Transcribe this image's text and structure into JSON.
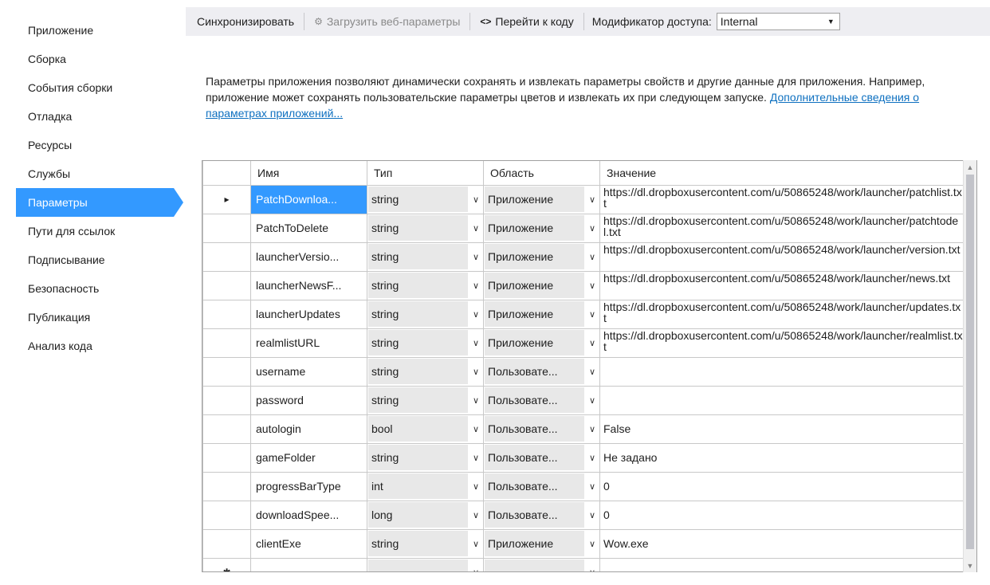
{
  "nav": {
    "items": [
      {
        "label": "Приложение"
      },
      {
        "label": "Сборка"
      },
      {
        "label": "События сборки"
      },
      {
        "label": "Отладка"
      },
      {
        "label": "Ресурсы"
      },
      {
        "label": "Службы"
      },
      {
        "label": "Параметры",
        "active": true
      },
      {
        "label": "Пути для ссылок"
      },
      {
        "label": "Подписывание"
      },
      {
        "label": "Безопасность"
      },
      {
        "label": "Публикация"
      },
      {
        "label": "Анализ кода"
      }
    ]
  },
  "toolbar": {
    "sync_label": "Синхронизировать",
    "load_web_label": "Загрузить веб-параметры",
    "goto_code_label": "Перейти к коду",
    "access_modifier_label": "Модификатор доступа:",
    "access_modifier_value": "Internal"
  },
  "description": {
    "text": "Параметры приложения позволяют динамически сохранять и извлекать параметры свойств и другие данные для приложения. Например, приложение может сохранять пользовательские параметры цветов и извлекать их при следующем запуске.",
    "link": "Дополнительные сведения о параметрах приложений..."
  },
  "grid": {
    "columns": {
      "name": "Имя",
      "type": "Тип",
      "scope": "Область",
      "value": "Значение"
    },
    "rows": [
      {
        "marker": "▸",
        "name": "PatchDownloa...",
        "type": "string",
        "scope": "Приложение",
        "value": "https://dl.dropboxusercontent.com/u/50865248/work/launcher/patchlist.txt"
      },
      {
        "marker": "",
        "name": "PatchToDelete",
        "type": "string",
        "scope": "Приложение",
        "value": "https://dl.dropboxusercontent.com/u/50865248/work/launcher/patchtodel.txt"
      },
      {
        "marker": "",
        "name": "launcherVersio...",
        "type": "string",
        "scope": "Приложение",
        "value": "https://dl.dropboxusercontent.com/u/50865248/work/launcher/version.txt"
      },
      {
        "marker": "",
        "name": "launcherNewsF...",
        "type": "string",
        "scope": "Приложение",
        "value": "https://dl.dropboxusercontent.com/u/50865248/work/launcher/news.txt"
      },
      {
        "marker": "",
        "name": "launcherUpdates",
        "type": "string",
        "scope": "Приложение",
        "value": "https://dl.dropboxusercontent.com/u/50865248/work/launcher/updates.txt"
      },
      {
        "marker": "",
        "name": "realmlistURL",
        "type": "string",
        "scope": "Приложение",
        "value": "https://dl.dropboxusercontent.com/u/50865248/work/launcher/realmlist.txt"
      },
      {
        "marker": "",
        "name": "username",
        "type": "string",
        "scope": "Пользовате...",
        "value": ""
      },
      {
        "marker": "",
        "name": "password",
        "type": "string",
        "scope": "Пользовате...",
        "value": ""
      },
      {
        "marker": "",
        "name": "autologin",
        "type": "bool",
        "scope": "Пользовате...",
        "value": "False"
      },
      {
        "marker": "",
        "name": "gameFolder",
        "type": "string",
        "scope": "Пользовате...",
        "value": "Не задано"
      },
      {
        "marker": "",
        "name": "progressBarType",
        "type": "int",
        "scope": "Пользовате...",
        "value": "0"
      },
      {
        "marker": "",
        "name": "downloadSpee...",
        "type": "long",
        "scope": "Пользовате...",
        "value": "0"
      },
      {
        "marker": "",
        "name": "clientExe",
        "type": "string",
        "scope": "Приложение",
        "value": "Wow.exe"
      },
      {
        "marker": "✱",
        "name": "",
        "type": "",
        "scope": "",
        "value": ""
      }
    ]
  },
  "icons": {
    "load_web": "web-settings-icon",
    "goto_code": "code-brackets-icon",
    "dropdown": "chevron-down-icon"
  }
}
